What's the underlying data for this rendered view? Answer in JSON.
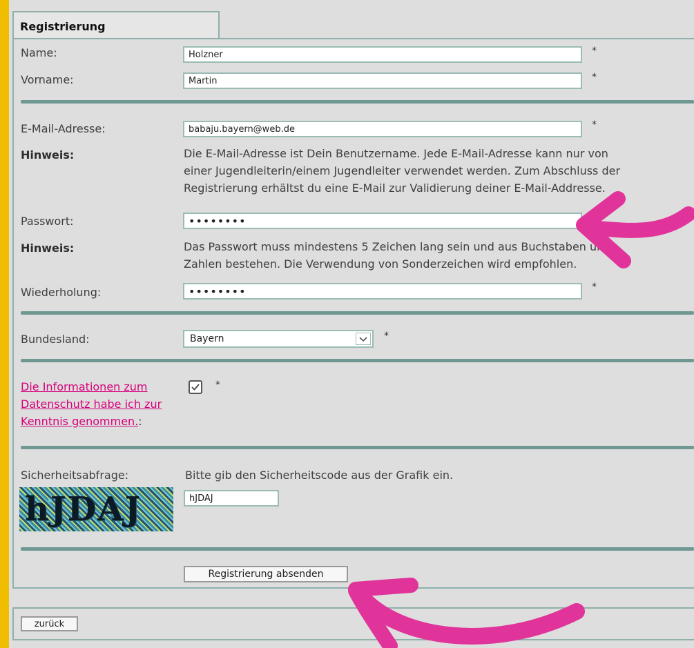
{
  "form": {
    "title": "Registrierung",
    "required_marker": "*",
    "name": {
      "label": "Name:",
      "value": "Holzner"
    },
    "vorname": {
      "label": "Vorname:",
      "value": "Martin"
    },
    "email": {
      "label": "E-Mail-Adresse:",
      "value": "babaju.bayern@web.de"
    },
    "hint_email": {
      "label": "Hinweis:",
      "lines": [
        "Die E-Mail-Adresse ist Dein Benutzername. Jede E-Mail-Adresse kann nur von",
        "einer Jugendleiterin/einem Jugendleiter verwendet werden. Zum Abschluss der",
        "Registrierung erhältst du eine E-Mail zur Validierung deiner E-Mail-Addresse."
      ]
    },
    "password": {
      "label": "Passwort:",
      "value": "••••••••"
    },
    "hint_password": {
      "label": "Hinweis:",
      "lines": [
        "Das Passwort muss mindestens 5 Zeichen lang sein und aus Buchstaben und",
        "Zahlen bestehen. Die Verwendung von Sonderzeichen wird empfohlen."
      ]
    },
    "repeat": {
      "label": "Wiederholung:",
      "value": "••••••••"
    },
    "state": {
      "label": "Bundesland:",
      "selected": "Bayern"
    },
    "privacy": {
      "lines": [
        "Die Informationen zum",
        "Datenschutz habe ich zur",
        "Kenntnis genommen."
      ],
      "suffix": ":",
      "checked": true
    },
    "captcha": {
      "label": "Sicherheitsabfrage:",
      "instruction": "Bitte gib den Sicherheitscode aus der Grafik ein.",
      "image_text": "hJDAJ",
      "value": "hJDAJ"
    },
    "submit_label": "Registrierung absenden"
  },
  "footer": {
    "back_label": "zurück"
  },
  "colors": {
    "page_background": "#f0bd00",
    "panel_background": "#dedede",
    "border": "#8fb0ab",
    "link": "#d6007a",
    "annotation_arrow": "#e0349a"
  },
  "annotations": [
    "arrow-icon",
    "arrow-icon"
  ]
}
